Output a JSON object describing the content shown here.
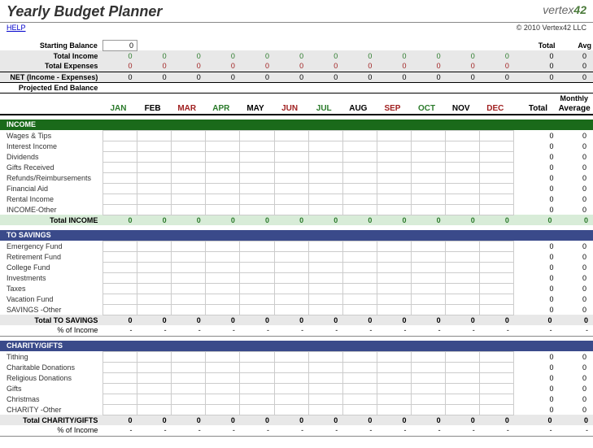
{
  "header": {
    "title": "Yearly Budget Planner",
    "logo_prefix": "vertex",
    "logo_suffix": "42",
    "help": "HELP",
    "copyright": "© 2010 Vertex42 LLC"
  },
  "summary": {
    "starting_balance_label": "Starting Balance",
    "starting_balance_value": "0",
    "total_income_label": "Total Income",
    "total_expenses_label": "Total Expenses",
    "net_label": "NET (Income - Expenses)",
    "projected_label": "Projected End Balance",
    "total_header": "Total",
    "avg_header": "Avg",
    "monthly_header": "Monthly",
    "total_header2": "Total",
    "average_header": "Average"
  },
  "months": [
    {
      "abbr": "JAN",
      "cls": "m-green"
    },
    {
      "abbr": "FEB",
      "cls": "m-black"
    },
    {
      "abbr": "MAR",
      "cls": "m-red"
    },
    {
      "abbr": "APR",
      "cls": "m-green"
    },
    {
      "abbr": "MAY",
      "cls": "m-black"
    },
    {
      "abbr": "JUN",
      "cls": "m-red"
    },
    {
      "abbr": "JUL",
      "cls": "m-green"
    },
    {
      "abbr": "AUG",
      "cls": "m-black"
    },
    {
      "abbr": "SEP",
      "cls": "m-red"
    },
    {
      "abbr": "OCT",
      "cls": "m-green"
    },
    {
      "abbr": "NOV",
      "cls": "m-black"
    },
    {
      "abbr": "DEC",
      "cls": "m-red"
    }
  ],
  "sections": [
    {
      "name": "INCOME",
      "cls": "sect-green",
      "rows": [
        "Wages & Tips",
        "Interest Income",
        "Dividends",
        "Gifts Received",
        "Refunds/Reimbursements",
        "Financial Aid",
        "Rental Income",
        "INCOME-Other"
      ],
      "subtotal_label": "Total INCOME",
      "subtotal_cls": "subtotal-green",
      "has_pct": false
    },
    {
      "name": "TO SAVINGS",
      "cls": "sect-blue",
      "rows": [
        "Emergency Fund",
        "Retirement Fund",
        "College Fund",
        "Investments",
        "Taxes",
        "Vacation Fund",
        "SAVINGS -Other"
      ],
      "subtotal_label": "Total TO SAVINGS",
      "subtotal_cls": "subtotal-grey",
      "has_pct": true,
      "pct_label": "% of Income"
    },
    {
      "name": "CHARITY/GIFTS",
      "cls": "sect-blue",
      "rows": [
        "Tithing",
        "Charitable Donations",
        "Religious Donations",
        "Gifts",
        "Christmas",
        "CHARITY -Other"
      ],
      "subtotal_label": "Total CHARITY/GIFTS",
      "subtotal_cls": "subtotal-grey",
      "has_pct": true,
      "pct_label": "% of Income"
    }
  ],
  "zero": "0",
  "dash": "-"
}
